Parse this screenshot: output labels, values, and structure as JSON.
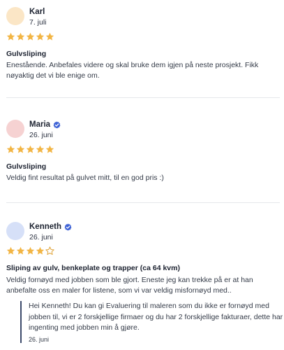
{
  "colors": {
    "star_filled": "#f2b544",
    "star_empty": "#e0a43a",
    "verified": "#3f63d6",
    "avatar_karl": "#fbe6c6",
    "avatar_maria": "#f6d2d2",
    "avatar_kenneth": "#d6e0f8",
    "reply_border": "#3c4a6b"
  },
  "reviews": [
    {
      "name": "Karl",
      "verified": false,
      "date": "7. juli",
      "rating": 5,
      "title": "Gulvsliping",
      "text": "Enestående. Anbefales videre og skal bruke dem igjen på neste prosjekt. Fikk nøyaktig det vi ble enige om."
    },
    {
      "name": "Maria",
      "verified": true,
      "date": "26. juni",
      "rating": 5,
      "title": "Gulvsliping",
      "text": "Veldig fint resultat på gulvet mitt, til en god pris :)"
    },
    {
      "name": "Kenneth",
      "verified": true,
      "date": "26. juni",
      "rating": 4,
      "title": "Sliping av gulv, benkeplate og trapper (ca 64 kvm)",
      "text": "Veldig fornøyd med jobben som ble gjort. Eneste jeg kan trekke på er at han anbefalte oss en maler for listene, som vi var veldig misfornøyd med..",
      "reply": {
        "text": "Hei Kenneth! Du kan gi Evaluering til maleren som du ikke er fornøyd med jobben til, vi er 2 forskjellige firmaer og du har 2 forskjellige fakturaer, dette har ingenting med jobben min å gjøre.",
        "date": "26. juni"
      }
    }
  ]
}
